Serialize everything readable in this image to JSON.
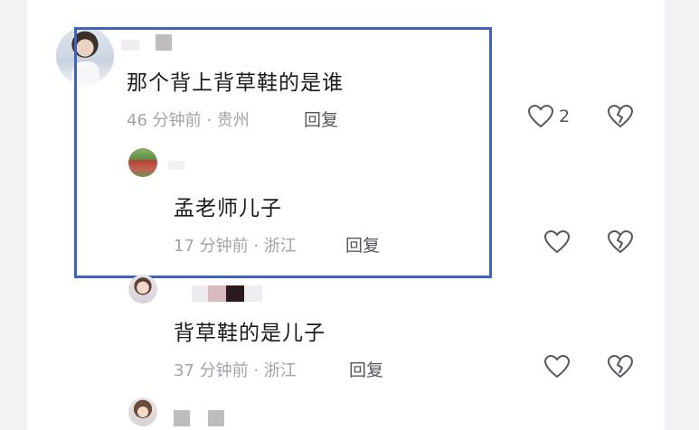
{
  "comments": [
    {
      "text": "那个背上背草鞋的是谁",
      "meta": "46 分钟前 · 贵州",
      "reply_label": "回复",
      "like_count": "2",
      "avatar": "user-photo-avatar"
    },
    {
      "text": "孟老师儿子",
      "meta": "17 分钟前 · 浙江",
      "reply_label": "回复",
      "like_count": "",
      "avatar": "user-photo-avatar"
    },
    {
      "text": "背草鞋的是儿子",
      "meta": "37 分钟前 · 浙江",
      "reply_label": "回复",
      "like_count": "",
      "avatar": "user-photo-avatar"
    }
  ],
  "icons": {
    "like": "heart-outline-icon",
    "dislike": "broken-heart-outline-icon"
  },
  "colors": {
    "highlight_border": "#3d63be",
    "meta_text": "#a3a3a8",
    "comment_text": "#1a1a1a"
  }
}
